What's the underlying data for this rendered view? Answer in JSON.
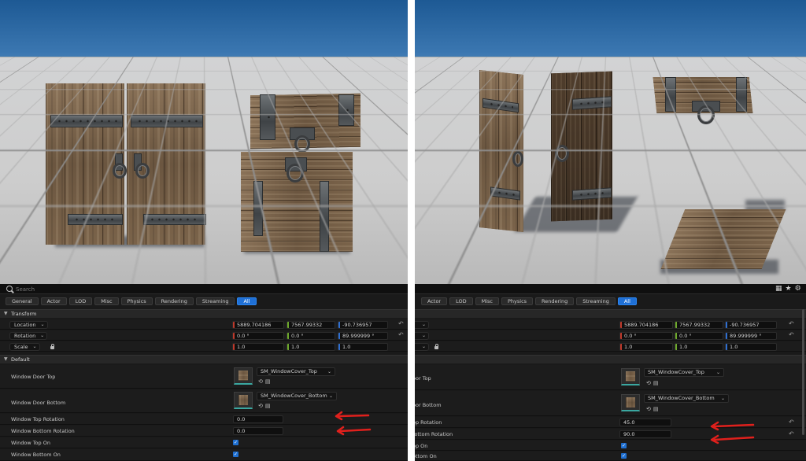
{
  "search": {
    "placeholder": "Search"
  },
  "tabs": [
    "General",
    "Actor",
    "LOD",
    "Misc",
    "Physics",
    "Rendering",
    "Streaming",
    "All"
  ],
  "active_tab": "All",
  "sections": {
    "transform": "Transform",
    "default": "Default"
  },
  "transform_left": {
    "location_label": "Location",
    "rotation_label": "Rotation",
    "scale_label": "Scale",
    "location": [
      "5889.704186",
      "7567.99332",
      "-90.736957"
    ],
    "rotation": [
      "0.0 °",
      "0.0 °",
      "89.999999 °"
    ],
    "scale": [
      "1.0",
      "1.0",
      "1.0"
    ]
  },
  "transform_right": {
    "location": [
      "5889.704186",
      "7567.99332",
      "-90.736957"
    ],
    "rotation": [
      "0.0 °",
      "0.0 °",
      "89.999999 °"
    ],
    "scale": [
      "1.0",
      "1.0",
      "1.0"
    ]
  },
  "left_props": {
    "door_top_label": "Window Door Top",
    "door_bottom_label": "Window Door Bottom",
    "top_rotation_label": "Window Top Rotation",
    "bottom_rotation_label": "Window Bottom Rotation",
    "top_on_label": "Window Top On",
    "bottom_on_label": "Window Bottom On"
  },
  "right_props": {
    "door_top_label": "oor Top",
    "door_bottom_label": "oor Bottom",
    "top_rotation_label": "op Rotation",
    "bottom_rotation_label": "Bottom Rotation",
    "top_on_label": "op On",
    "bottom_on_label": "ottom On"
  },
  "assets": {
    "top": "SM_WindowCover_Top",
    "bottom": "SM_WindowCover_Bottom"
  },
  "values_left": {
    "top_rotation": "0.0",
    "bottom_rotation": "0.0"
  },
  "values_right": {
    "top_rotation": "45.0",
    "bottom_rotation": "90.0"
  },
  "colors": {
    "accent": "#1f70d6",
    "arrow": "#e0201c",
    "x_axis": "#c0392b",
    "y_axis": "#6ea92c",
    "z_axis": "#2f6fd1"
  },
  "icons": [
    "search-icon",
    "grid-icon",
    "star-icon",
    "gear-icon",
    "reset-arrow-icon",
    "lock-icon",
    "browse-icon",
    "folder-icon",
    "checkbox-icon"
  ]
}
